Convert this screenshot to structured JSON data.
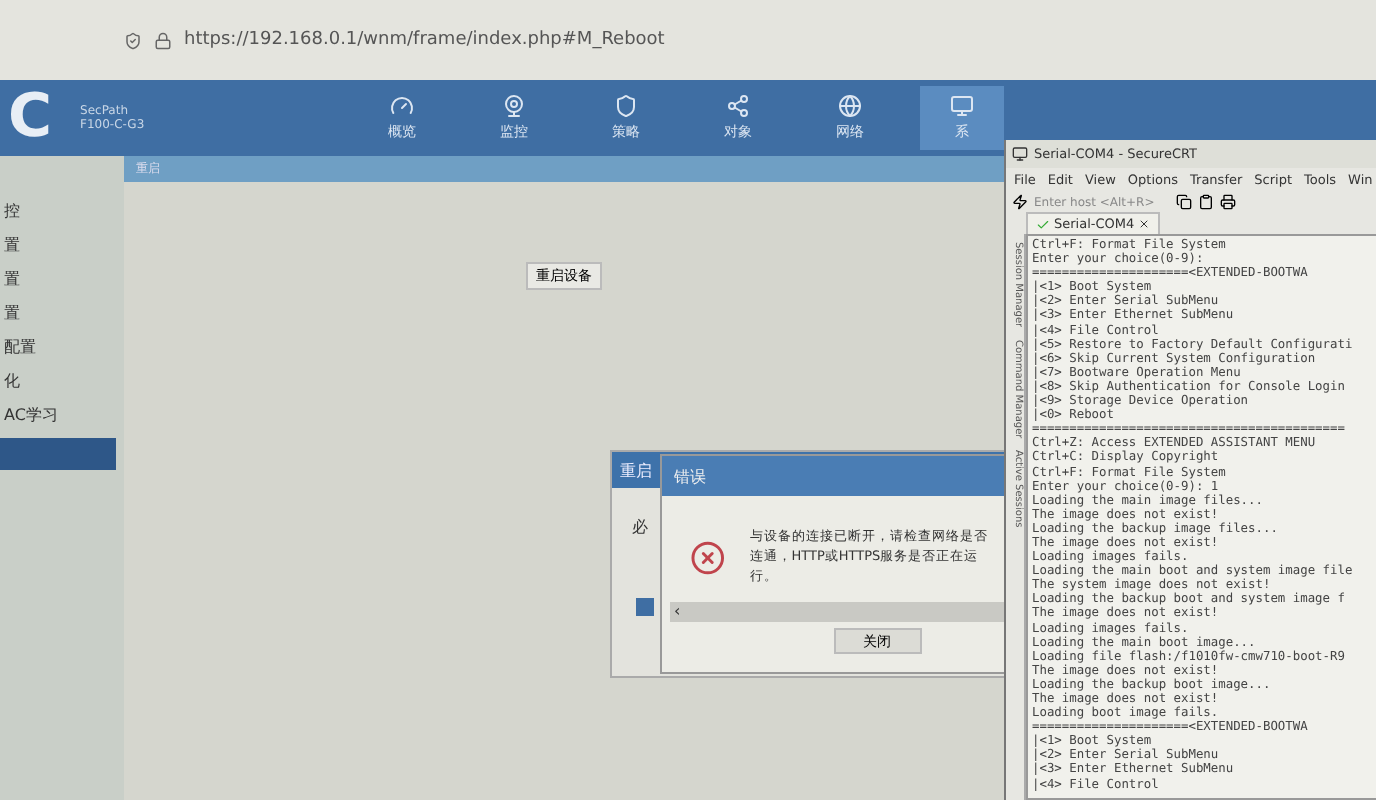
{
  "address_bar": {
    "url": "https://192.168.0.1/wnm/frame/index.php#M_Reboot"
  },
  "header": {
    "logo": "C",
    "product": "SecPath",
    "model": "F100-C-G3",
    "nav": [
      {
        "label": "概览",
        "selected": false
      },
      {
        "label": "监控",
        "selected": false
      },
      {
        "label": "策略",
        "selected": false
      },
      {
        "label": "对象",
        "selected": false
      },
      {
        "label": "网络",
        "selected": false
      },
      {
        "label": "系",
        "selected": true
      }
    ]
  },
  "breadcrumb": "重启",
  "sidebar": {
    "items": [
      {
        "label": "控",
        "selected": false
      },
      {
        "label": "置",
        "selected": false
      },
      {
        "label": "置",
        "selected": false
      },
      {
        "label": "置",
        "selected": false
      },
      {
        "label": "配置",
        "selected": false
      },
      {
        "label": "化",
        "selected": false
      },
      {
        "label": "AC学习",
        "selected": false
      },
      {
        "selected": true
      }
    ]
  },
  "content": {
    "button": "重启设备"
  },
  "reboot_panel": {
    "title": "重启",
    "text": "必",
    "checked": true
  },
  "error_dialog": {
    "title": "错误",
    "message": "与设备的连接已断开，请检查网络是否连通，HTTP或HTTPS服务是否正在运行。",
    "scroll_arrow": "‹",
    "button": "关闭"
  },
  "terminal_window": {
    "title": "Serial-COM4 - SecureCRT",
    "menu": [
      "File",
      "Edit",
      "View",
      "Options",
      "Transfer",
      "Script",
      "Tools",
      "Win"
    ],
    "host_placeholder": "Enter host <Alt+R>",
    "tab": "Serial-COM4",
    "side_tabs": [
      "Session Manager",
      "Command Manager",
      "Active Sessions"
    ],
    "lines": [
      "Ctrl+F: Format File System",
      "Enter your choice(0-9):",
      "=====================<EXTENDED-BOOTWA",
      "|<1> Boot System",
      "|<2> Enter Serial SubMenu",
      "|<3> Enter Ethernet SubMenu",
      "|<4> File Control",
      "|<5> Restore to Factory Default Configurati",
      "|<6> Skip Current System Configuration",
      "|<7> Bootware Operation Menu",
      "|<8> Skip Authentication for Console Login",
      "|<9> Storage Device Operation",
      "|<0> Reboot",
      "==========================================",
      "Ctrl+Z: Access EXTENDED ASSISTANT MENU",
      "Ctrl+C: Display Copyright",
      "Ctrl+F: Format File System",
      "Enter your choice(0-9): 1",
      "Loading the main image files...",
      "The image does not exist!",
      "Loading the backup image files...",
      "The image does not exist!",
      "Loading images fails.",
      "Loading the main boot and system image file",
      "The system image does not exist!",
      "Loading the backup boot and system image f",
      "The image does not exist!",
      "Loading images fails.",
      "Loading the main boot image...",
      "Loading file flash:/f1010fw-cmw710-boot-R9",
      "The image does not exist!",
      "Loading the backup boot image...",
      "The image does not exist!",
      "Loading boot image fails.",
      "=====================<EXTENDED-BOOTWA",
      "|<1> Boot System",
      "|<2> Enter Serial SubMenu",
      "|<3> Enter Ethernet SubMenu",
      "|<4> File Control"
    ]
  }
}
